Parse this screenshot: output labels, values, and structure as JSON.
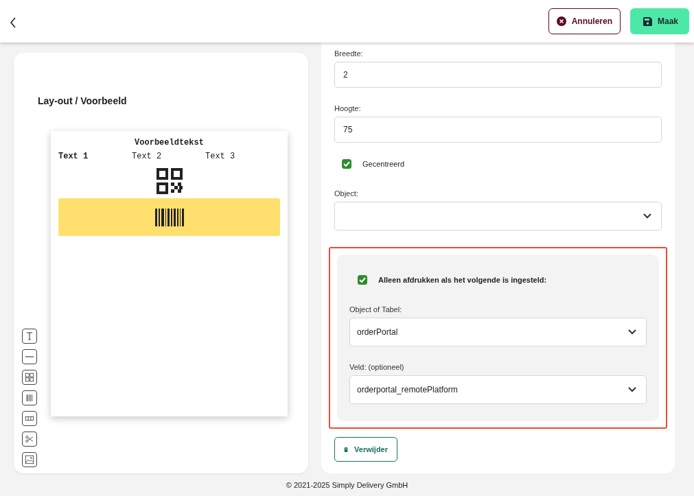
{
  "header": {
    "buttons": [
      {
        "kind": "cancel",
        "label": "Annuleren"
      },
      {
        "kind": "save",
        "label": "Maak"
      }
    ]
  },
  "preview": {
    "title": "Lay-out / Voorbeeld",
    "label": {
      "heading": "Voorbeeldtekst",
      "texts": [
        {
          "text": "Text 1",
          "bold": true
        },
        {
          "text": "Text 2",
          "bold": false
        },
        {
          "text": "Text 3",
          "bold": false
        }
      ]
    }
  },
  "form": {
    "fields": [
      {
        "kind": "input",
        "label": "Breedte:",
        "value": "2"
      },
      {
        "kind": "input",
        "label": "Hoogte:",
        "value": "75"
      },
      {
        "kind": "checkbox",
        "label": "Gecentreerd",
        "checked": true
      },
      {
        "kind": "select",
        "label": "Object:"
      }
    ],
    "condition": {
      "highlighted": true,
      "checkbox": {
        "label": "Alleen afdrukken als het volgende is ingesteld:",
        "checked": true
      },
      "fields": [
        {
          "kind": "select",
          "label": "Object of Tabel:",
          "value": "orderPortal"
        },
        {
          "kind": "select",
          "label": "Veld: (optioneel)",
          "value": "orderportal_remotePlatform"
        }
      ]
    },
    "delete_button": "Verwijder"
  },
  "footer": "© 2021-2025 Simply Delivery GmbH"
}
